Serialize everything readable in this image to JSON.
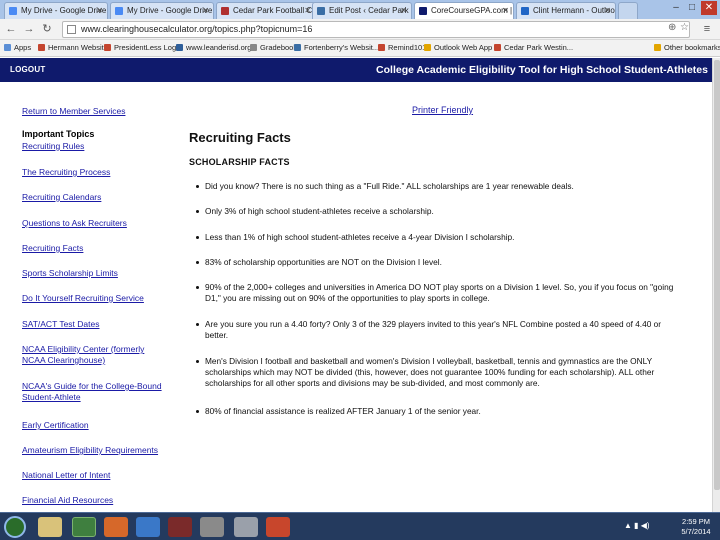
{
  "browser": {
    "tabs": [
      {
        "label": "My Drive - Google Drive",
        "color": "#4a8af4",
        "active": false
      },
      {
        "label": "My Drive - Google Drive",
        "color": "#4a8af4",
        "active": false
      },
      {
        "label": "Cedar Park Football Coach",
        "color": "#b03030",
        "active": false
      },
      {
        "label": "Edit Post ‹ Cedar Park Foo",
        "color": "#3a6ea5",
        "active": false
      },
      {
        "label": "CoreCourseGPA.com | for",
        "color": "#0f1a6c",
        "active": true
      },
      {
        "label": "Clint Hermann - Outlook",
        "color": "#2066c6",
        "active": false
      }
    ],
    "url": "www.clearinghousecalculator.org/topics.php?topicnum=16",
    "bookmarks": [
      {
        "label": "Apps",
        "color": "#5b8fd6"
      },
      {
        "label": "Hermann Website",
        "color": "#c4452f"
      },
      {
        "label": "PresidentLess Login",
        "color": "#c4452f"
      },
      {
        "label": "www.leanderisd.org",
        "color": "#2f5f9a"
      },
      {
        "label": "Gradebook",
        "color": "#888888"
      },
      {
        "label": "Fortenberry's Websit...",
        "color": "#3a6ea5"
      },
      {
        "label": "Remind101",
        "color": "#c4452f"
      },
      {
        "label": "Outlook Web App",
        "color": "#e2a500"
      },
      {
        "label": "Cedar Park Westin...",
        "color": "#c4452f"
      },
      {
        "label": "Other bookmarks",
        "color": "#e2a500"
      }
    ]
  },
  "header": {
    "logout": "LOGOUT",
    "title": "College Academic Eligibility Tool for High School Student-Athletes"
  },
  "sidebar": {
    "return_link": "Return to Member Services",
    "heading": "Important Topics",
    "links": [
      "Recruiting Rules",
      "The Recruiting Process",
      "Recruiting Calendars",
      "Questions to Ask Recruiters",
      "Recruiting Facts",
      "Sports Scholarship Limits",
      "Do It Yourself Recruiting Service",
      "SAT/ACT Test Dates",
      "NCAA Eligibility Center (formerly NCAA Clearinghouse)",
      "NCAA's Guide for the College-Bound Student-Athlete",
      "Early Certification",
      "Amateurism Eligibility Requirements",
      "National Letter of Intent",
      "Financial Aid Resources"
    ]
  },
  "main": {
    "printer_friendly": "Printer Friendly",
    "title": "Recruiting Facts",
    "subtitle": "SCHOLARSHIP FACTS",
    "facts": [
      "Did you know? There is no such thing as a \"Full Ride.\" ALL scholarships are 1 year renewable deals.",
      "Only 3% of high school student-athletes receive a scholarship.",
      "Less than 1% of high school student-athletes receive a 4-year Division I scholarship.",
      "83% of scholarship opportunities are NOT on the Division I level.",
      "90% of the 2,000+ colleges and universities in America DO NOT play sports on a Division 1 level. So, you if you focus on \"going D1,\" you are missing out on 90% of the opportunities to play sports in college.",
      "Are you sure you run a 4.40 forty? Only 3 of the 329 players invited to this year's NFL Combine posted a 40 speed of 4.40 or better.",
      "Men's Division I football and basketball and women's Division I volleyball, basketball, tennis and gymnastics are the ONLY scholarships which may NOT be divided (this, however, does not guarantee 100% funding for each scholarship). ALL other scholarships for all other sports and divisions may be sub-divided, and most commonly are.",
      "80% of financial assistance is realized AFTER January 1 of the senior year."
    ]
  },
  "taskbar": {
    "time": "2:59 PM",
    "date": "5/7/2014"
  }
}
